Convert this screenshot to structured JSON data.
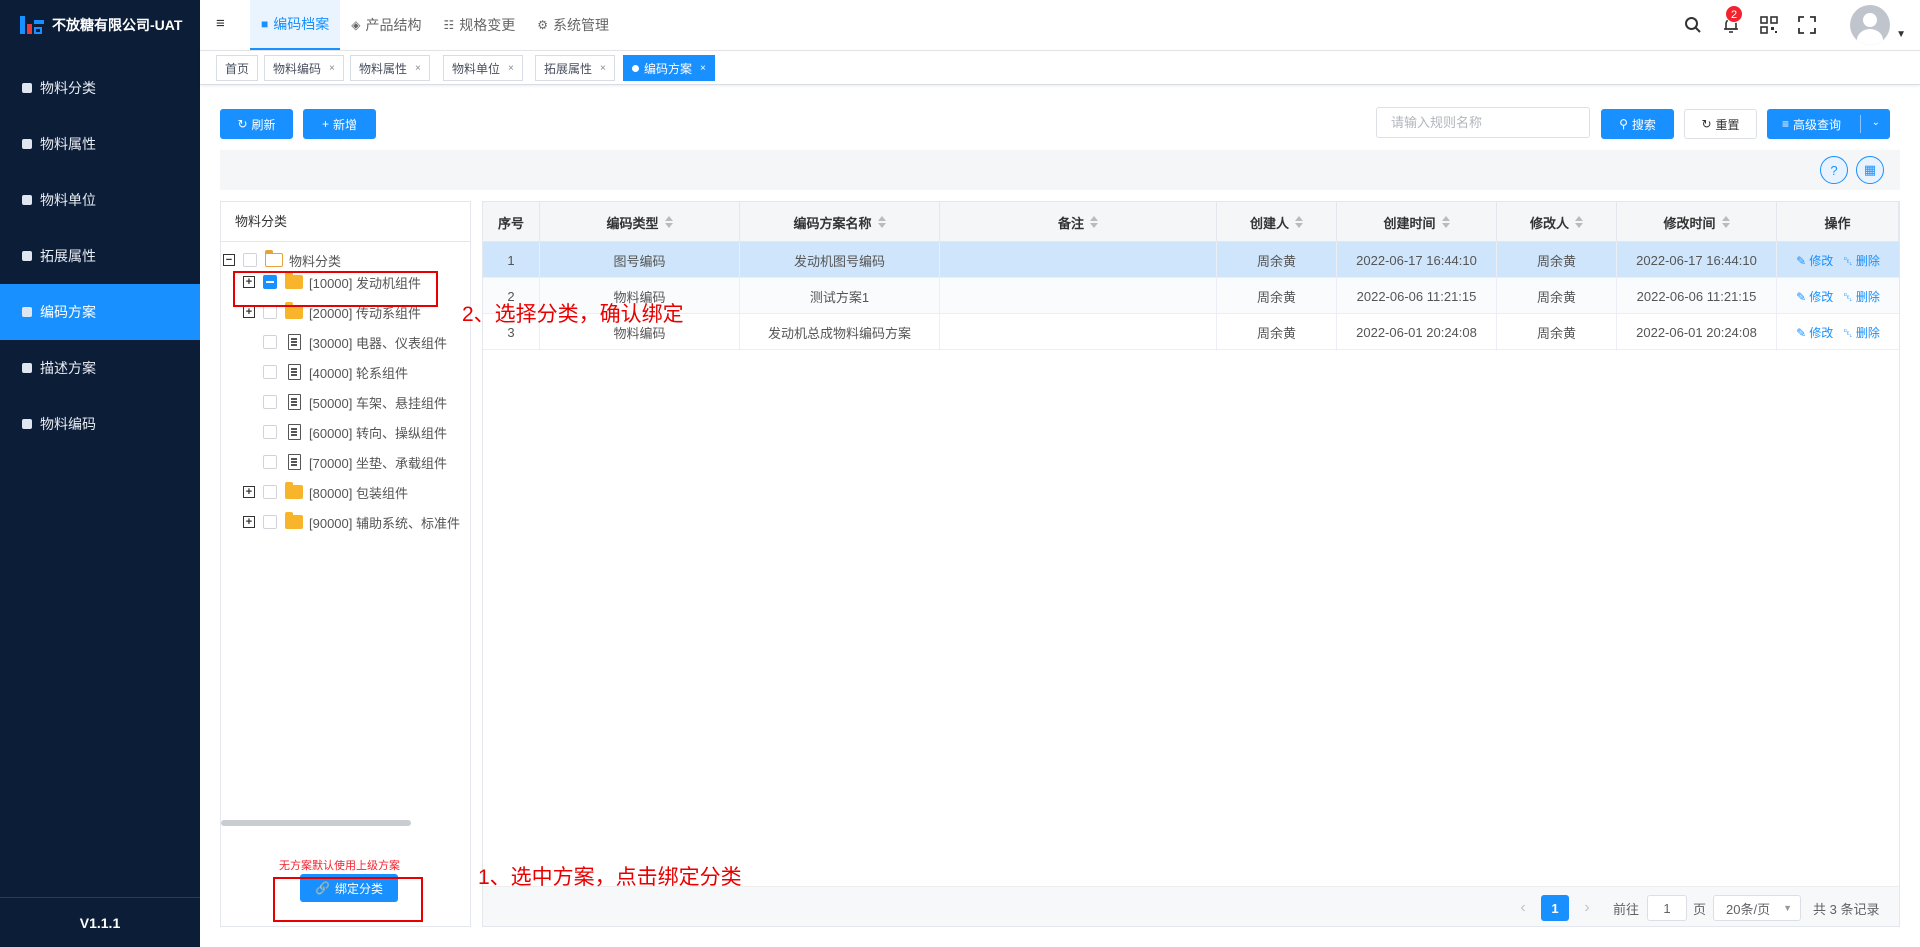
{
  "app": {
    "title": "不放糖有限公司-UAT",
    "version": "V1.1.1"
  },
  "sidebar": {
    "items": [
      {
        "label": "物料分类"
      },
      {
        "label": "物料属性"
      },
      {
        "label": "物料单位"
      },
      {
        "label": "拓展属性"
      },
      {
        "label": "编码方案",
        "active": true
      },
      {
        "label": "描述方案"
      },
      {
        "label": "物料编码"
      }
    ]
  },
  "topnav": {
    "items": [
      {
        "label": "编码档案",
        "icon": "folder-icon",
        "active": true
      },
      {
        "label": "产品结构",
        "icon": "layers-icon"
      },
      {
        "label": "规格变更",
        "icon": "structure-icon"
      },
      {
        "label": "系统管理",
        "icon": "gear-icon"
      }
    ]
  },
  "header": {
    "notification_count": "2"
  },
  "tags": [
    {
      "label": "首页"
    },
    {
      "label": "物料编码",
      "close": "×"
    },
    {
      "label": "物料属性",
      "close": "×"
    },
    {
      "label": "物料单位",
      "close": "×"
    },
    {
      "label": "拓展属性",
      "close": "×"
    },
    {
      "label": "编码方案",
      "close": "×",
      "active": true
    }
  ],
  "toolbar": {
    "refresh_label": "刷新",
    "add_label": "新增",
    "search_placeholder": "请输入规则名称",
    "search_label": "搜索",
    "reset_label": "重置",
    "advanced_label": "高级查询"
  },
  "tree": {
    "title": "物料分类",
    "root": "物料分类",
    "nodes": [
      {
        "label": "[10000] 发动机组件"
      },
      {
        "label": "[20000] 传动系组件"
      },
      {
        "label": "[30000] 电器、仪表组件"
      },
      {
        "label": "[40000] 轮系组件"
      },
      {
        "label": "[50000] 车架、悬挂组件"
      },
      {
        "label": "[60000] 转向、操纵组件"
      },
      {
        "label": "[70000] 坐垫、承载组件"
      },
      {
        "label": "[80000] 包装组件"
      },
      {
        "label": "[90000] 辅助系统、标准件"
      }
    ],
    "hint": "无方案默认使用上级方案",
    "bind_label": "绑定分类"
  },
  "table": {
    "columns": [
      "序号",
      "编码类型",
      "编码方案名称",
      "备注",
      "创建人",
      "创建时间",
      "修改人",
      "修改时间",
      "操作"
    ],
    "rows": [
      {
        "no": "1",
        "type": "图号编码",
        "name": "发动机图号编码",
        "remark": "",
        "creator": "周余黄",
        "created": "2022-06-17 16:44:10",
        "modifier": "周余黄",
        "modified": "2022-06-17 16:44:10"
      },
      {
        "no": "2",
        "type": "物料编码",
        "name": "测试方案1",
        "remark": "",
        "creator": "周余黄",
        "created": "2022-06-06 11:21:15",
        "modifier": "周余黄",
        "modified": "2022-06-06 11:21:15"
      },
      {
        "no": "3",
        "type": "物料编码",
        "name": "发动机总成物料编码方案",
        "remark": "",
        "creator": "周余黄",
        "created": "2022-06-01 20:24:08",
        "modifier": "周余黄",
        "modified": "2022-06-01 20:24:08"
      }
    ],
    "edit_label": "修改",
    "delete_label": "删除"
  },
  "pagination": {
    "current": "1",
    "goto_prefix": "前往",
    "goto_value": "1",
    "goto_suffix": "页",
    "page_size": "20条/页",
    "total": "共 3 条记录"
  },
  "annotations": {
    "step1": "1、选中方案，点击绑定分类",
    "step2": "2、选择分类，确认绑定"
  },
  "colors": {
    "primary": "#1890ff",
    "sidebar": "#0c1d37",
    "annotation": "#e80000"
  }
}
